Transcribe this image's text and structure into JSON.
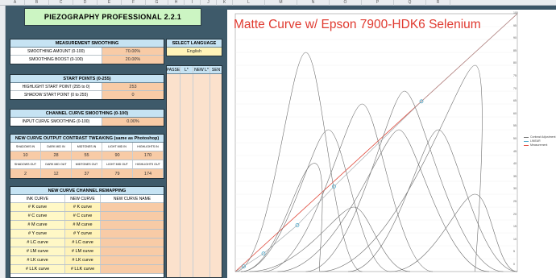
{
  "app": {
    "title": "PIEZOGRAPHY PROFESSIONAL 2.2.1",
    "column_letters": [
      "A",
      "B",
      "C",
      "D",
      "E",
      "F",
      "G",
      "H",
      "I",
      "J",
      "K",
      "L",
      "M",
      "N",
      "O",
      "P",
      "Q",
      "R"
    ]
  },
  "measurement_smoothing": {
    "header": "MEASUREMENT SMOOTHING",
    "rows": [
      {
        "label": "SMOOTHING AMOUNT (0-100)",
        "value": "70.00%"
      },
      {
        "label": "SMOOTHING BOOST (0-100)",
        "value": "20.00%"
      }
    ]
  },
  "language": {
    "header": "SELECT LANGUAGE",
    "value": "English",
    "columns": [
      "PASSE",
      "L*",
      "NEW L*",
      "SEN"
    ]
  },
  "start_points": {
    "header": "START POINTS (0-255)",
    "rows": [
      {
        "label": "HIGHLIGHT START POINT (255 to 0)",
        "value": "253"
      },
      {
        "label": "SHADOW START POINT (0 to 255)",
        "value": "0"
      }
    ]
  },
  "channel_smoothing": {
    "header": "CHANNEL CURVE SMOOTHING (0-100)",
    "rows": [
      {
        "label": "INPUT CURVE SMOOTHING (0-100)",
        "value": "0.00%"
      }
    ]
  },
  "contrast": {
    "header": "NEW CURVE OUTPUT CONTRAST TWEAKING (same as Photoshop)",
    "in_labels": [
      "SHADOWS IN",
      "DARK MID IN",
      "MIDTONES IN",
      "LIGHT MID IN",
      "HIGHLIGHTS IN"
    ],
    "in_values": [
      "10",
      "28",
      "55",
      "90",
      "170"
    ],
    "out_labels": [
      "SHADOWS OUT",
      "DARK MID OUT",
      "MIDTONES OUT",
      "LIGHT MID OUT",
      "HIGHLIGHTS OUT"
    ],
    "out_values": [
      "2",
      "12",
      "37",
      "79",
      "174"
    ]
  },
  "remapping": {
    "header": "NEW CURVE CHANNEL REMAPPING",
    "col_headers": [
      "INK CURVE",
      "NEW CURVE",
      "NEW CURVE NAME"
    ],
    "rows": [
      {
        "ink": "# K curve",
        "new": "# K curve"
      },
      {
        "ink": "# C curve",
        "new": "# C curve"
      },
      {
        "ink": "# M curve",
        "new": "# M curve"
      },
      {
        "ink": "# Y curve",
        "new": "# Y curve"
      },
      {
        "ink": "# LC curve",
        "new": "# LC curve"
      },
      {
        "ink": "# LM curve",
        "new": "# LM curve"
      },
      {
        "ink": "# LK curve",
        "new": "# LK curve"
      },
      {
        "ink": "# LLK curve",
        "new": "# LLK curve"
      }
    ]
  },
  "chart": {
    "title": "Matte Curve w/ Epson 7900-HDK6 Selenium",
    "y_ticks": [
      "100",
      "95",
      "90",
      "85",
      "80",
      "75",
      "70",
      "65",
      "60",
      "55",
      "50",
      "45",
      "40",
      "35",
      "30",
      "25",
      "20",
      "15",
      "10",
      "5",
      "0"
    ],
    "legend": [
      "Contrast Adjustment",
      "LINEAR",
      "Measurement"
    ],
    "colors": {
      "linear": "#e04a3c",
      "contrast": "#4aa7c8",
      "curves": "#6e6e6e"
    }
  }
}
